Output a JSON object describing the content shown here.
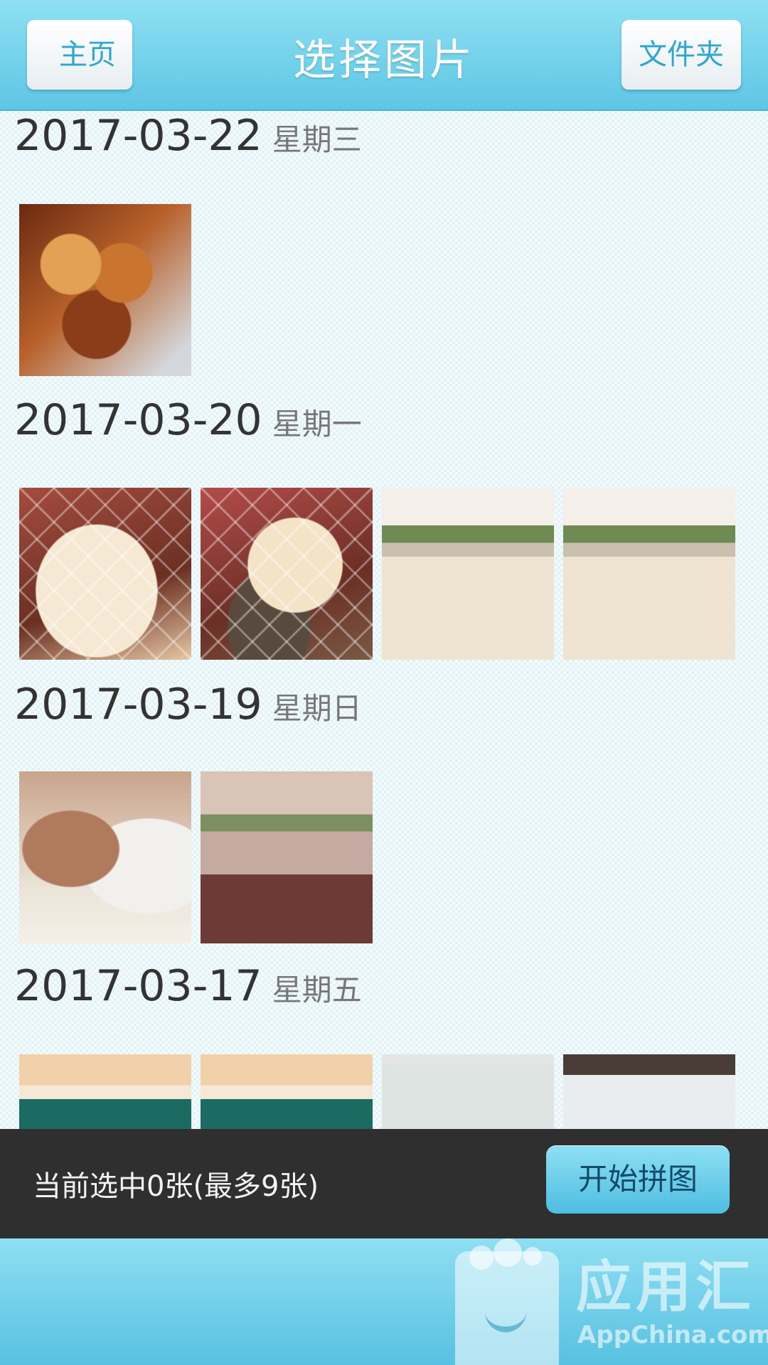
{
  "header": {
    "title": "选择图片",
    "back_label": "主页",
    "folder_label": "文件夹"
  },
  "groups": [
    {
      "date": "2017-03-22",
      "weekday": "星期三",
      "photos": [
        "food"
      ]
    },
    {
      "date": "2017-03-20",
      "weekday": "星期一",
      "photos": [
        "dog",
        "dog",
        "dining-hall",
        "dining-hall"
      ]
    },
    {
      "date": "2017-03-19",
      "weekday": "星期日",
      "photos": [
        "coffee",
        "dining-hall"
      ]
    },
    {
      "date": "2017-03-17",
      "weekday": "星期五",
      "photos": [
        "classroom",
        "classroom",
        "slide",
        "slide"
      ]
    }
  ],
  "bottom_bar": {
    "status": "当前选中0张(最多9张)",
    "start_label": "开始拼图"
  },
  "watermark": {
    "text": "应用汇",
    "sub": "AppChina.com"
  },
  "colors": {
    "header": "#6fd0ec",
    "bottom_bar": "#2f2f2f",
    "accent": "#2fa6cf"
  }
}
